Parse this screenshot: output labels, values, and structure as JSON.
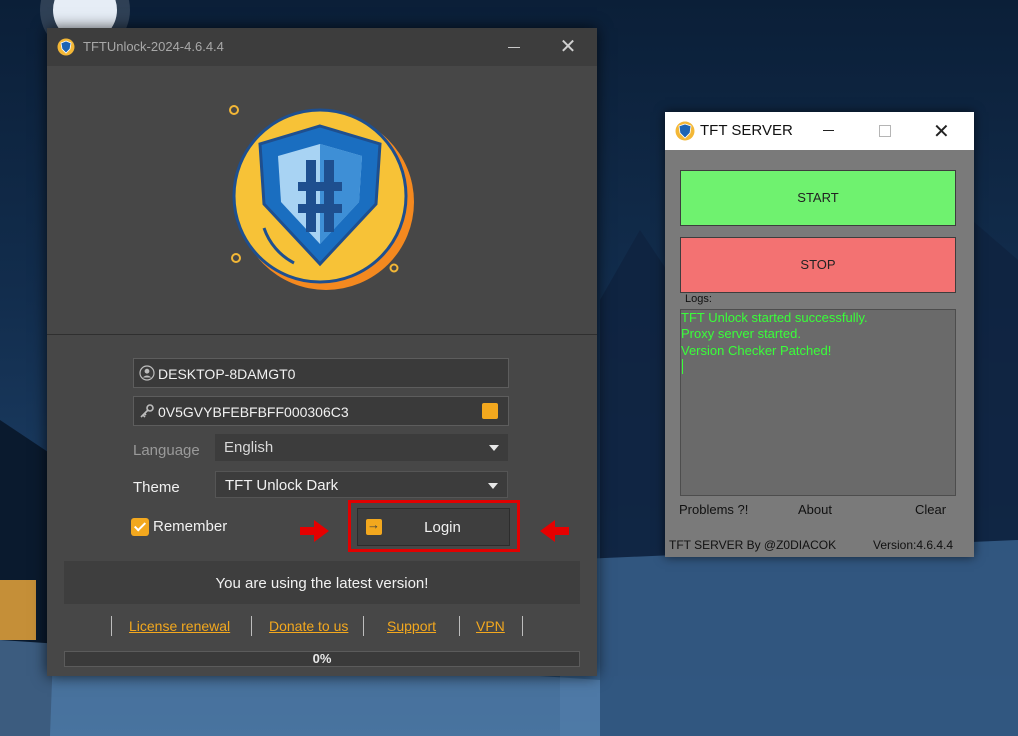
{
  "main_window": {
    "title": "TFTUnlock-2024-4.6.4.4",
    "device_name": "DESKTOP-8DAMGT0",
    "license_key": "0V5GVYBFEBFBFF000306C3",
    "language_label": "Language",
    "language_value": "English",
    "theme_label": "Theme",
    "theme_value": "TFT Unlock Dark",
    "remember_label": "Remember",
    "remember_checked": true,
    "login_label": "Login",
    "status_text": "You are using the latest version!",
    "links": [
      "License renewal",
      "Donate to us",
      "Support",
      "VPN"
    ],
    "progress_text": "0%",
    "progress_value": 0,
    "accent_color": "#f3a81e"
  },
  "server_window": {
    "title": "TFT SERVER",
    "start_label": "START",
    "stop_label": "STOP",
    "logs_label": "Logs:",
    "log_lines": [
      "TFT Unlock started successfully.",
      "Proxy server started.",
      "Version Checker Patched!"
    ],
    "problems_label": "Problems ?!",
    "about_label": "About",
    "clear_label": "Clear",
    "footer_author": "TFT SERVER By @Z0DIACOK",
    "footer_version": "Version:4.6.4.4",
    "start_color": "#6ff26f",
    "stop_color": "#f37272",
    "log_text_color": "#39ff39"
  }
}
